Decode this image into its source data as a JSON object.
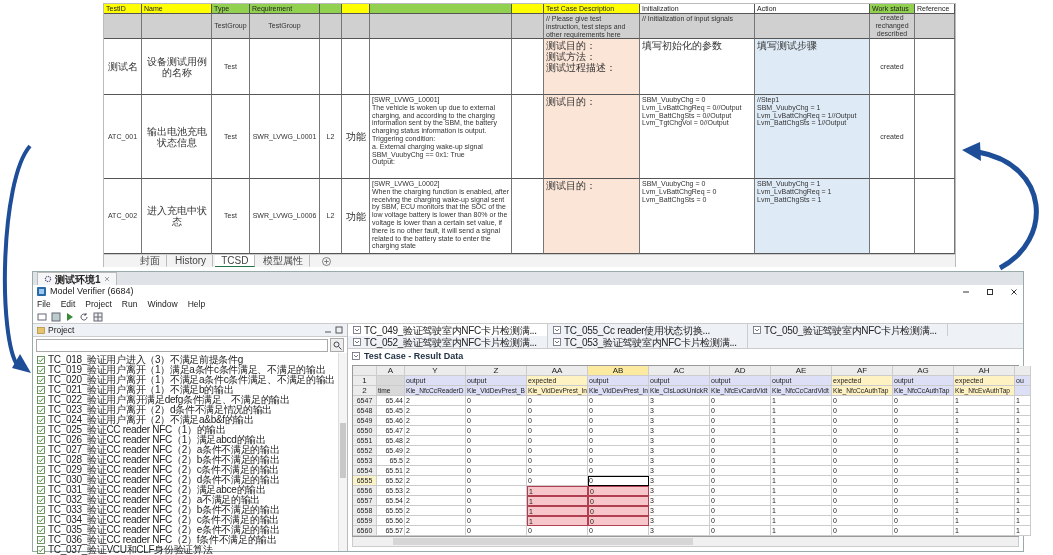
{
  "sheet": {
    "columns": [
      {
        "label": "TestID",
        "color": "#ffff00"
      },
      {
        "label": "Name",
        "color": "#ffff00"
      },
      {
        "label": "Type",
        "color": "#92d050"
      },
      {
        "label": "Requirement",
        "color": "#92d050"
      },
      {
        "color": "#92d050"
      },
      {
        "color": "#ffff00"
      },
      {
        "color": "#92d050"
      },
      {
        "color": "#ffff00"
      },
      {
        "label": "Test Case Description",
        "color": "#ffff00",
        "kind": "description"
      },
      {
        "label": "Initialization",
        "color": "#ffffff"
      },
      {
        "label": "Action",
        "color": "#ffffff",
        "kind": "action"
      },
      {
        "label": "Work status",
        "color": "#92d050"
      },
      {
        "label": "Reference",
        "color": "#ffffff"
      }
    ],
    "rows": [
      {
        "kind": "defaults",
        "cells": [
          null,
          null,
          [
            "TestGroup"
          ],
          [
            "TestGroup"
          ],
          null,
          null,
          null,
          null,
          [
            "// Please give test instruction, test steps and other requirements here"
          ],
          [
            "// Initialization of input signals"
          ],
          null,
          [
            "created",
            "rechanged",
            "described"
          ],
          null
        ]
      },
      {
        "kind": "case",
        "cells": [
          [
            "测试名"
          ],
          [
            "设备测试用例的名称"
          ],
          [
            "Test"
          ],
          null,
          null,
          null,
          null,
          null,
          [
            "测试目的：",
            "测试方法：",
            "测试过程描述："
          ],
          [
            "填写初始化的参数"
          ],
          [
            "填写测试步骤"
          ],
          [
            "created"
          ],
          null
        ]
      },
      {
        "kind": "case",
        "cells": [
          [
            "ATC_001"
          ],
          [
            "输出电池充电状态信息"
          ],
          [
            "Test"
          ],
          [
            "SWR_LVWG_L0001"
          ],
          [
            "L2"
          ],
          [
            "功能"
          ],
          [
            "[SWR_LVWG_L0001]",
            "The vehicle is woken up due to external charging, and according to the charging information sent by the SBM, the battery charging status information is output.",
            "Triggering condition:",
            "a. External charging wake-up signal SBM_VuubyChg == 0x1: True",
            "Output:"
          ],
          null,
          [
            "测试目的："
          ],
          [
            "SBM_VuubyChg = 0",
            "Lvm_LvBattChgReq = 0//Output",
            "Lvm_BattChgSts = 0//Output",
            "Lvm_TgtChgVol = 0//Output"
          ],
          [
            "//Step1",
            "SBM_VuubyChg = 1",
            "Lvm_LvBattChgReq = 1//Output",
            "Lvm_BattChgSts = 1//Output"
          ],
          [
            "created"
          ],
          null
        ]
      },
      {
        "kind": "case",
        "cells": [
          [
            "ATC_002"
          ],
          [
            "进入充电中状态"
          ],
          [
            "Test"
          ],
          [
            "SWR_LVWG_L0006"
          ],
          [
            "L2"
          ],
          [
            "功能"
          ],
          [
            "[SWR_LVWG_L0002]",
            "When the charging function is enabled, after receiving the charging wake-up signal sent by SBM, ECU monitors that the SOC of the low voltage battery is lower than 80% or the voltage is lower than a certain set value, if there is no other fault, it will send a signal related to the battery state to enter the charging state"
          ],
          null,
          [
            "测试目的："
          ],
          [
            "SBM_VuubyChg = 0",
            "Lvm_LvBattChgReq = 0",
            "Lvm_BattChgSts = 0"
          ],
          [
            "SBM_VuubyChg = 1",
            "Lvm_LvBattChgReq = 1",
            "Lvm_BattChgSts = 1"
          ],
          null,
          null
        ]
      }
    ],
    "tabs": [
      {
        "label": "封面",
        "selected": false
      },
      {
        "label": "History",
        "selected": false
      },
      {
        "label": "TCSD",
        "selected": true
      },
      {
        "label": "模型属性",
        "selected": false
      }
    ]
  },
  "app": {
    "tab": "测试环境1",
    "title": "Model Verifier (6684)",
    "menus": [
      "File",
      "Edit",
      "Project",
      "Run",
      "Window",
      "Help"
    ],
    "project_panel": {
      "title": "Project",
      "tests": [
        "TC_018_验证用户进入（3）不满足前提条件g",
        "TC_019_验证用户离开（1）满足a条件c条件满足、不满足的输出",
        "TC_020_验证用户离开（1）不满足a条件c条件满足、不满足的输出",
        "TC_021_验证用户离开（1）不满足b的输出",
        "TC_022_验证用户离开满足defg条件满足、不满足的输出",
        "TC_023_验证用户离开（2）d条件不满足情况的输出",
        "TC_024_验证用户离开（2）不满足a&b&f的输出",
        "TC_025_验证CC reader NFC（1）的输出",
        "TC_026_验证CC reader NFC（1）满足abcd的输出",
        "TC_027_验证CC reader NFC（2）a条件不满足的输出",
        "TC_028_验证CC reader NFC（2）b条件不满足的输出",
        "TC_029_验证CC reader NFC（2）c条件不满足的输出",
        "TC_030_验证CC reader NFC（2）d条件不满足的输出",
        "TC_031_验证CC reader NFC（2）满足abce的输出",
        "TC_032_验证CC reader NFC（2）a不满足的输出",
        "TC_033_验证CC reader NFC（2）b条件不满足的输出",
        "TC_034_验证CC reader NFC（2）c条件不满足的输出",
        "TC_035_验证CC reader NFC（2）e条件不满足的输出",
        "TC_036_验证CC reader NFC（2）f条件不满足的输出",
        "TC_037_验证VCU和CLF身份验证算法"
      ]
    },
    "editor_tabs": [
      {
        "label": "TC_049_验证驾驶室内NFC卡片检测满...",
        "selected": true
      },
      {
        "label": "TC_055_Cc reader使用状态切换...",
        "selected": false
      },
      {
        "label": "TC_050_验证驾驶室内NFC卡片检测满...",
        "selected": false
      },
      {
        "label": "TC_052_验证驾驶室内NFC卡片检测满...",
        "selected": false
      },
      {
        "label": "TC_053_验证驾驶室内NFC卡片检测满...",
        "selected": false
      }
    ],
    "result": {
      "title": "Test Case - Result Data",
      "header_numbers": [
        "1",
        "2"
      ],
      "columns": [
        {
          "letter": "A",
          "kind": "time",
          "signal": "time",
          "selected": false,
          "compared": false
        },
        {
          "letter": "Y",
          "kind": "output",
          "label": "output",
          "signal": "Kle_NfcCcReaderD",
          "selected": false,
          "compared": false
        },
        {
          "letter": "Z",
          "kind": "output",
          "label": "output",
          "signal": "Kle_VldDevPrest_B",
          "selected": false,
          "compared": false
        },
        {
          "letter": "AA",
          "kind": "expected",
          "label": "expected",
          "signal": "Kle_VldDevPrest_In",
          "selected": false,
          "compared": true
        },
        {
          "letter": "AB",
          "kind": "output",
          "label": "output",
          "signal": "Kle_VldDevPrest_In",
          "selected": true,
          "compared": true
        },
        {
          "letter": "AC",
          "kind": "output",
          "label": "output",
          "signal": "Kle_ClsLockUnlckR",
          "selected": false,
          "compared": false
        },
        {
          "letter": "AD",
          "kind": "output",
          "label": "output",
          "signal": "Kle_NfcEvCardVldt",
          "selected": false,
          "compared": false
        },
        {
          "letter": "AE",
          "kind": "output",
          "label": "output",
          "signal": "Kle_NfcCcCardVldt",
          "selected": false,
          "compared": false
        },
        {
          "letter": "AF",
          "kind": "expected",
          "label": "expected",
          "signal": "Kle_NfcCcAuthTap",
          "selected": false,
          "compared": false
        },
        {
          "letter": "AG",
          "kind": "output",
          "label": "output",
          "signal": "Kle_NfcCcAuthTap",
          "selected": false,
          "compared": false
        },
        {
          "letter": "AH",
          "kind": "expected",
          "label": "expected",
          "signal": "Kle_NfcEvAuthTap",
          "selected": false,
          "compared": false
        },
        {
          "kind": "output",
          "label": "ou",
          "selected": false,
          "compared": false
        }
      ],
      "rows": [
        {
          "number": "6547",
          "selected": false,
          "mismatch": false,
          "cells": [
            "65.44",
            "2",
            "0",
            "0",
            "0",
            "3",
            "0",
            "1",
            "0",
            "0",
            "1",
            "1"
          ]
        },
        {
          "number": "6548",
          "selected": false,
          "mismatch": false,
          "cells": [
            "65.45",
            "2",
            "0",
            "0",
            "0",
            "3",
            "0",
            "1",
            "0",
            "0",
            "1",
            "1"
          ]
        },
        {
          "number": "6549",
          "selected": false,
          "mismatch": false,
          "cells": [
            "65.46",
            "2",
            "0",
            "0",
            "0",
            "3",
            "0",
            "1",
            "0",
            "0",
            "1",
            "1"
          ]
        },
        {
          "number": "6550",
          "selected": false,
          "mismatch": false,
          "cells": [
            "65.47",
            "2",
            "0",
            "0",
            "0",
            "3",
            "0",
            "1",
            "0",
            "0",
            "1",
            "1"
          ]
        },
        {
          "number": "6551",
          "selected": false,
          "mismatch": false,
          "cells": [
            "65.48",
            "2",
            "0",
            "0",
            "0",
            "3",
            "0",
            "1",
            "0",
            "0",
            "1",
            "1"
          ]
        },
        {
          "number": "6552",
          "selected": false,
          "mismatch": false,
          "cells": [
            "65.49",
            "2",
            "0",
            "0",
            "0",
            "3",
            "0",
            "1",
            "0",
            "0",
            "1",
            "1"
          ]
        },
        {
          "number": "6553",
          "selected": false,
          "mismatch": false,
          "cells": [
            "65.5",
            "2",
            "0",
            "0",
            "0",
            "3",
            "0",
            "1",
            "0",
            "0",
            "1",
            "1"
          ]
        },
        {
          "number": "6554",
          "selected": false,
          "mismatch": false,
          "cells": [
            "65.51",
            "2",
            "0",
            "0",
            "0",
            "3",
            "0",
            "1",
            "0",
            "0",
            "1",
            "1"
          ]
        },
        {
          "number": "6555",
          "selected": true,
          "mismatch": false,
          "cells": [
            "65.52",
            "2",
            "0",
            "0",
            "0",
            "3",
            "0",
            "1",
            "0",
            "0",
            "1",
            "1"
          ]
        },
        {
          "number": "6556",
          "selected": false,
          "mismatch": true,
          "cells": [
            "65.53",
            "2",
            "0",
            "1",
            "0",
            "3",
            "0",
            "1",
            "0",
            "0",
            "1",
            "1"
          ]
        },
        {
          "number": "6557",
          "selected": false,
          "mismatch": true,
          "cells": [
            "65.54",
            "2",
            "0",
            "1",
            "0",
            "3",
            "0",
            "1",
            "0",
            "0",
            "1",
            "1"
          ]
        },
        {
          "number": "6558",
          "selected": false,
          "mismatch": true,
          "cells": [
            "65.55",
            "2",
            "0",
            "1",
            "0",
            "3",
            "0",
            "1",
            "0",
            "0",
            "1",
            "1"
          ]
        },
        {
          "number": "6559",
          "selected": false,
          "mismatch": true,
          "cells": [
            "65.56",
            "2",
            "0",
            "1",
            "0",
            "3",
            "0",
            "1",
            "0",
            "0",
            "1",
            "1"
          ]
        },
        {
          "number": "6560",
          "selected": false,
          "mismatch": false,
          "cells": [
            "65.57",
            "2",
            "0",
            "0",
            "0",
            "3",
            "0",
            "1",
            "0",
            "0",
            "1",
            "1"
          ]
        }
      ]
    }
  }
}
